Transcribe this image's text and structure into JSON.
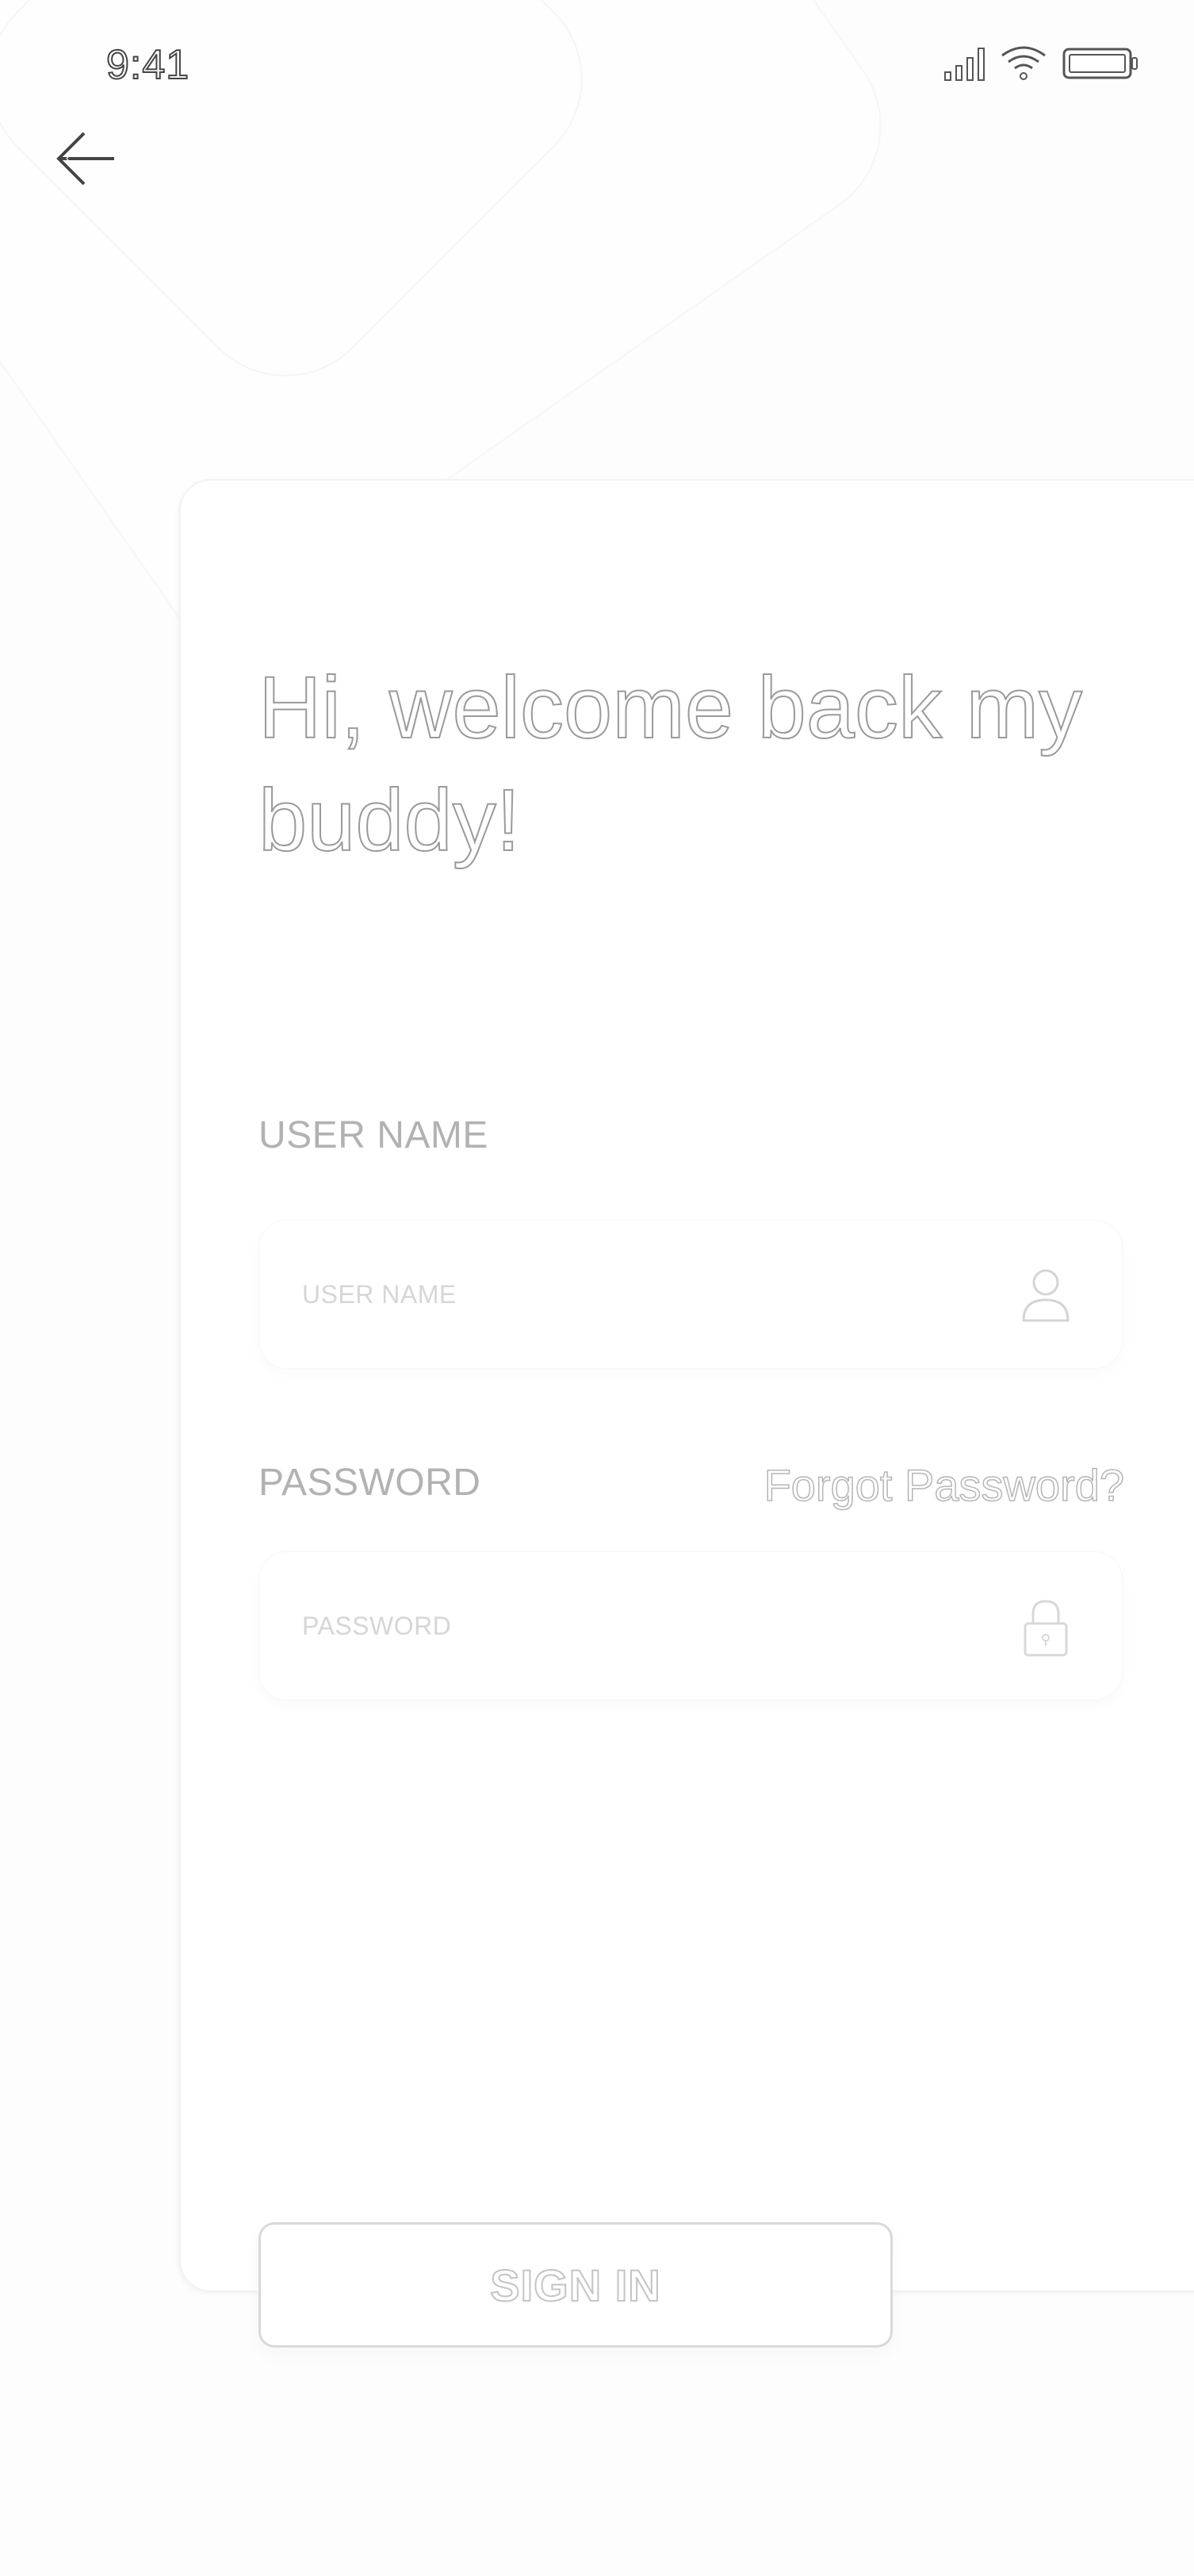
{
  "status_bar": {
    "time": "9:41"
  },
  "header": {
    "back_icon": "arrow-left-icon"
  },
  "login": {
    "welcome_title": "Hi, welcome back my buddy!",
    "username": {
      "label": "USER NAME",
      "placeholder": "USER NAME",
      "value": "",
      "icon": "user-icon"
    },
    "password": {
      "label": "PASSWORD",
      "placeholder": "PASSWORD",
      "value": "",
      "icon": "lock-icon"
    },
    "forgot_password": "Forgot Password?",
    "submit_label": "SIGN IN"
  },
  "colors": {
    "background": "#fdfdfd",
    "card": "#ffffff",
    "text_muted": "#b2b2b2",
    "outline": "#d9d9d9"
  }
}
